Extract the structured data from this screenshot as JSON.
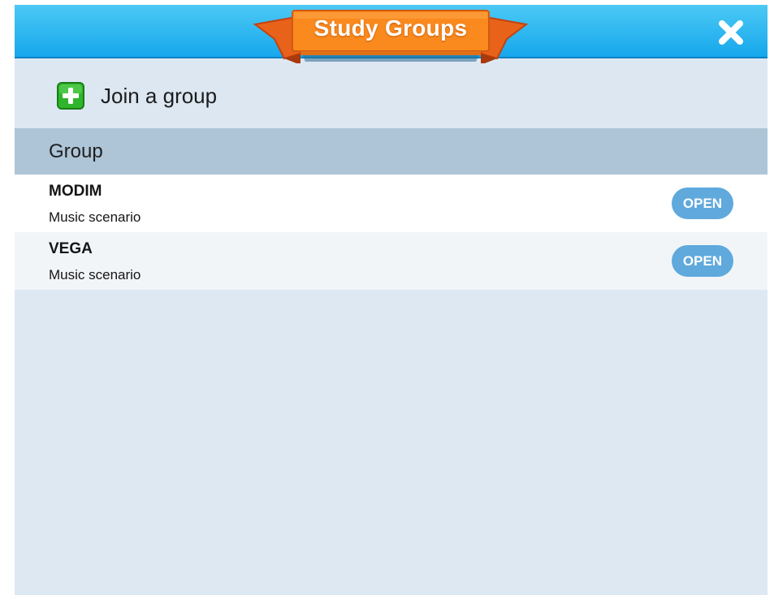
{
  "window": {
    "title": "Study Groups",
    "close_icon": "close-icon"
  },
  "join": {
    "label": "Join a group",
    "icon": "plus-icon"
  },
  "table": {
    "header": "Group",
    "rows": [
      {
        "name": "MODIM",
        "subtitle": "Music scenario",
        "action": "OPEN"
      },
      {
        "name": "VEGA",
        "subtitle": "Music scenario",
        "action": "OPEN"
      }
    ]
  },
  "colors": {
    "header_blue": "#16a7ec",
    "ribbon_orange": "#fa8a1e",
    "plus_green": "#2fb52b",
    "open_button": "#5fa9dd",
    "panel_bg": "#dde8f3",
    "table_header_bg": "#adc5d7"
  }
}
